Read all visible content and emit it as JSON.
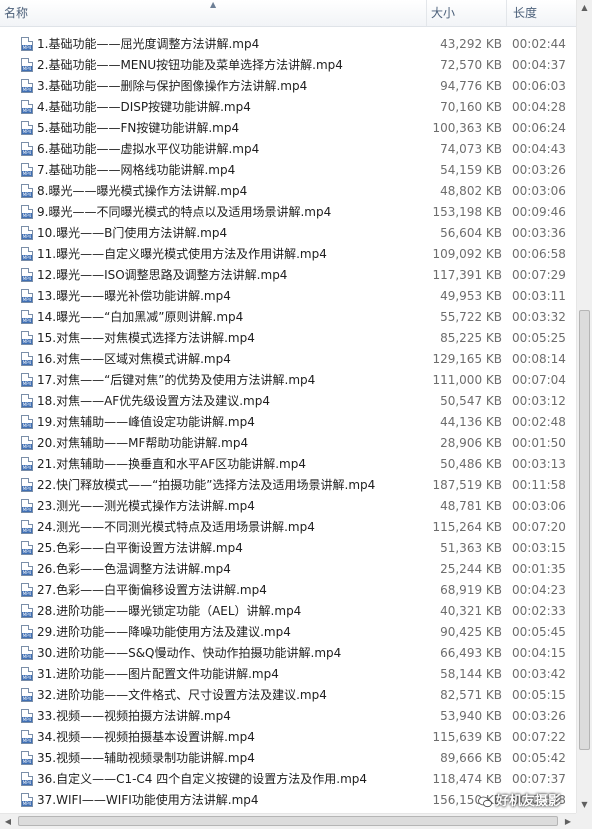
{
  "header": {
    "name_label": "名称",
    "size_label": "大小",
    "duration_label": "长度"
  },
  "files": [
    {
      "name": "1.基础功能——屈光度调整方法讲解.mp4",
      "size": "43,292 KB",
      "duration": "00:02:44"
    },
    {
      "name": "2.基础功能——MENU按钮功能及菜单选择方法讲解.mp4",
      "size": "72,570 KB",
      "duration": "00:04:37"
    },
    {
      "name": "3.基础功能——删除与保护图像操作方法讲解.mp4",
      "size": "94,776 KB",
      "duration": "00:06:03"
    },
    {
      "name": "4.基础功能——DISP按键功能讲解.mp4",
      "size": "70,160 KB",
      "duration": "00:04:28"
    },
    {
      "name": "5.基础功能——FN按键功能讲解.mp4",
      "size": "100,363 KB",
      "duration": "00:06:24"
    },
    {
      "name": "6.基础功能——虚拟水平仪功能讲解.mp4",
      "size": "74,073 KB",
      "duration": "00:04:43"
    },
    {
      "name": "7.基础功能——网格线功能讲解.mp4",
      "size": "54,159 KB",
      "duration": "00:03:26"
    },
    {
      "name": "8.曝光——曝光模式操作方法讲解.mp4",
      "size": "48,802 KB",
      "duration": "00:03:06"
    },
    {
      "name": "9.曝光——不同曝光模式的特点以及适用场景讲解.mp4",
      "size": "153,198 KB",
      "duration": "00:09:46"
    },
    {
      "name": "10.曝光——B门使用方法讲解.mp4",
      "size": "56,604 KB",
      "duration": "00:03:36"
    },
    {
      "name": "11.曝光——自定义曝光模式使用方法及作用讲解.mp4",
      "size": "109,092 KB",
      "duration": "00:06:58"
    },
    {
      "name": "12.曝光——ISO调整思路及调整方法讲解.mp4",
      "size": "117,391 KB",
      "duration": "00:07:29"
    },
    {
      "name": "13.曝光——曝光补偿功能讲解.mp4",
      "size": "49,953 KB",
      "duration": "00:03:11"
    },
    {
      "name": "14.曝光——“白加黑减”原则讲解.mp4",
      "size": "55,722 KB",
      "duration": "00:03:32"
    },
    {
      "name": "15.对焦——对焦模式选择方法讲解.mp4",
      "size": "85,225 KB",
      "duration": "00:05:25"
    },
    {
      "name": "16.对焦——区域对焦模式讲解.mp4",
      "size": "129,165 KB",
      "duration": "00:08:14"
    },
    {
      "name": "17.对焦——“后键对焦”的优势及使用方法讲解.mp4",
      "size": "111,000 KB",
      "duration": "00:07:04"
    },
    {
      "name": "18.对焦——AF优先级设置方法及建议.mp4",
      "size": "50,547 KB",
      "duration": "00:03:12"
    },
    {
      "name": "19.对焦辅助——峰值设定功能讲解.mp4",
      "size": "44,136 KB",
      "duration": "00:02:48"
    },
    {
      "name": "20.对焦辅助——MF帮助功能讲解.mp4",
      "size": "28,906 KB",
      "duration": "00:01:50"
    },
    {
      "name": "21.对焦辅助——换垂直和水平AF区功能讲解.mp4",
      "size": "50,486 KB",
      "duration": "00:03:13"
    },
    {
      "name": "22.快门释放模式——“拍摄功能”选择方法及适用场景讲解.mp4",
      "size": "187,519 KB",
      "duration": "00:11:58"
    },
    {
      "name": "23.测光——测光模式操作方法讲解.mp4",
      "size": "48,781 KB",
      "duration": "00:03:06"
    },
    {
      "name": "24.测光——不同测光模式特点及适用场景讲解.mp4",
      "size": "115,264 KB",
      "duration": "00:07:20"
    },
    {
      "name": "25.色彩——白平衡设置方法讲解.mp4",
      "size": "51,363 KB",
      "duration": "00:03:15"
    },
    {
      "name": "26.色彩——色温调整方法讲解.mp4",
      "size": "25,244 KB",
      "duration": "00:01:35"
    },
    {
      "name": "27.色彩——白平衡偏移设置方法讲解.mp4",
      "size": "68,919 KB",
      "duration": "00:04:23"
    },
    {
      "name": "28.进阶功能——曝光锁定功能（AEL）讲解.mp4",
      "size": "40,321 KB",
      "duration": "00:02:33"
    },
    {
      "name": "29.进阶功能——降噪功能使用方法及建议.mp4",
      "size": "90,425 KB",
      "duration": "00:05:45"
    },
    {
      "name": "30.进阶功能——S&Q慢动作、快动作拍摄功能讲解.mp4",
      "size": "66,493 KB",
      "duration": "00:04:15"
    },
    {
      "name": "31.进阶功能——图片配置文件功能讲解.mp4",
      "size": "58,144 KB",
      "duration": "00:03:42"
    },
    {
      "name": "32.进阶功能——文件格式、尺寸设置方法及建议.mp4",
      "size": "82,571 KB",
      "duration": "00:05:15"
    },
    {
      "name": "33.视频——视频拍摄方法讲解.mp4",
      "size": "53,940 KB",
      "duration": "00:03:26"
    },
    {
      "name": "34.视频——视频拍摄基本设置讲解.mp4",
      "size": "115,639 KB",
      "duration": "00:07:22"
    },
    {
      "name": "35.视频——辅助视频录制功能讲解.mp4",
      "size": "89,666 KB",
      "duration": "00:05:42"
    },
    {
      "name": "36.自定义——C1-C4 四个自定义按键的设置方法及作用.mp4",
      "size": "118,474 KB",
      "duration": "00:07:37"
    },
    {
      "name": "37.WIFI——WIFI功能使用方法讲解.mp4",
      "size": "156,150 KB",
      "duration": "00:09:58"
    }
  ],
  "watermark": {
    "text": "好机友摄影"
  }
}
